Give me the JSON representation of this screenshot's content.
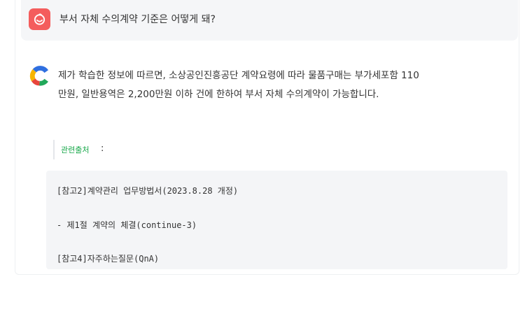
{
  "question": {
    "text": "부서 자체 수의계약 기준은 어떻게 돼?"
  },
  "answer": {
    "line1": "제가 학습한 정보에 따르면, 소상공인진흥공단 계약요령에 따라 물품구매는 부가세포함 110",
    "line2": "만원, 일반용역은 2,200만원 이하 건에 한하여 부서 자체 수의계약이 가능합니다."
  },
  "sources": {
    "label": "관련출처",
    "colon": ":",
    "items": [
      "[참고2]계약관리 업무방법서(2023.8.28 개정)",
      "- 제1절 계약의 체결(continue-3)",
      "[참고4]자주하는질문(QnA)"
    ]
  },
  "colors": {
    "user_avatar": "#f45d5d",
    "source_label": "#18a84a",
    "bot_logo_blue": "#2f6fe0",
    "bot_logo_yellow": "#f7b500",
    "bot_logo_red": "#e8453c",
    "bot_logo_green": "#22a85a"
  }
}
